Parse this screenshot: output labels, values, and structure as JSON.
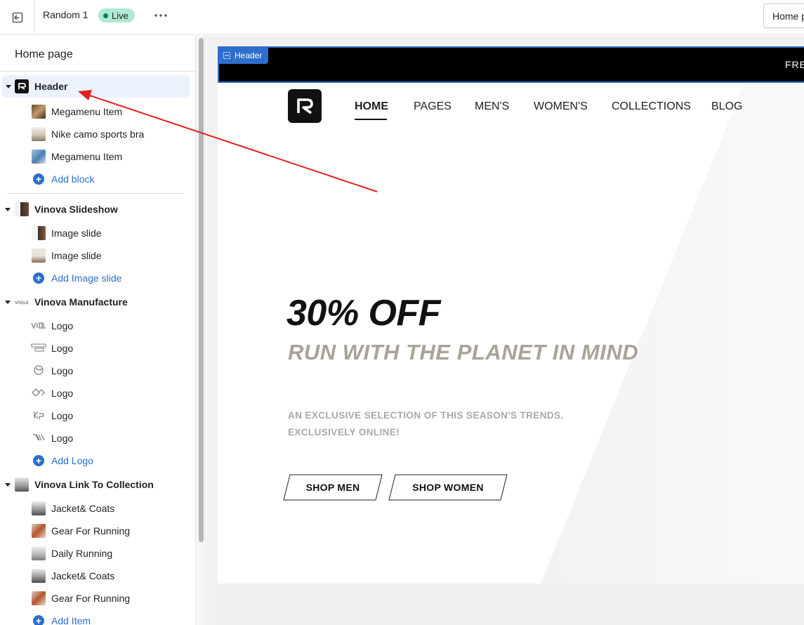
{
  "topbar": {
    "theme_name": "Random 1",
    "status": "Live",
    "page_selector": "Home page"
  },
  "sidebar": {
    "title": "Home page",
    "sections": [
      {
        "label": "Header",
        "selected": true,
        "blocks": [
          {
            "label": "Megamenu Item"
          },
          {
            "label": "Nike camo sports bra"
          },
          {
            "label": "Megamenu Item"
          }
        ],
        "add_label": "Add block"
      },
      {
        "label": "Vinova Slideshow",
        "blocks": [
          {
            "label": "Image slide"
          },
          {
            "label": "Image slide"
          }
        ],
        "add_label": "Add Image slide"
      },
      {
        "label": "Vinova Manufacture",
        "blocks": [
          {
            "label": "Logo"
          },
          {
            "label": "Logo"
          },
          {
            "label": "Logo"
          },
          {
            "label": "Logo"
          },
          {
            "label": "Logo"
          },
          {
            "label": "Logo"
          }
        ],
        "add_label": "Add Logo"
      },
      {
        "label": "Vinova Link To Collection",
        "blocks": [
          {
            "label": "Jacket& Coats"
          },
          {
            "label": "Gear For Running"
          },
          {
            "label": "Daily Running"
          },
          {
            "label": "Jacket& Coats"
          },
          {
            "label": "Gear For Running"
          }
        ],
        "add_label": "Add Item"
      }
    ]
  },
  "preview": {
    "section_tag": "Header",
    "announcement": "FRE",
    "nav": [
      "HOME",
      "PAGES",
      "MEN'S",
      "WOMEN'S",
      "COLLECTIONS",
      "BLOG"
    ],
    "hero": {
      "headline": "30% OFF",
      "subheadline": "RUN WITH THE PLANET IN MIND",
      "desc_line1": "AN EXCLUSIVE SELECTION OF THIS SEASON'S TRENDS.",
      "desc_line2": "EXCLUSIVELY ONLINE!",
      "btn_men": "SHOP MEN",
      "btn_women": "SHOP WOMEN"
    }
  },
  "colors": {
    "accent": "#2c6ecb",
    "live_badge": "#aee9d1",
    "selected_row": "#ebf2fe",
    "annotation_arrow": "#e32020",
    "hero_sub": "#a9a397"
  }
}
